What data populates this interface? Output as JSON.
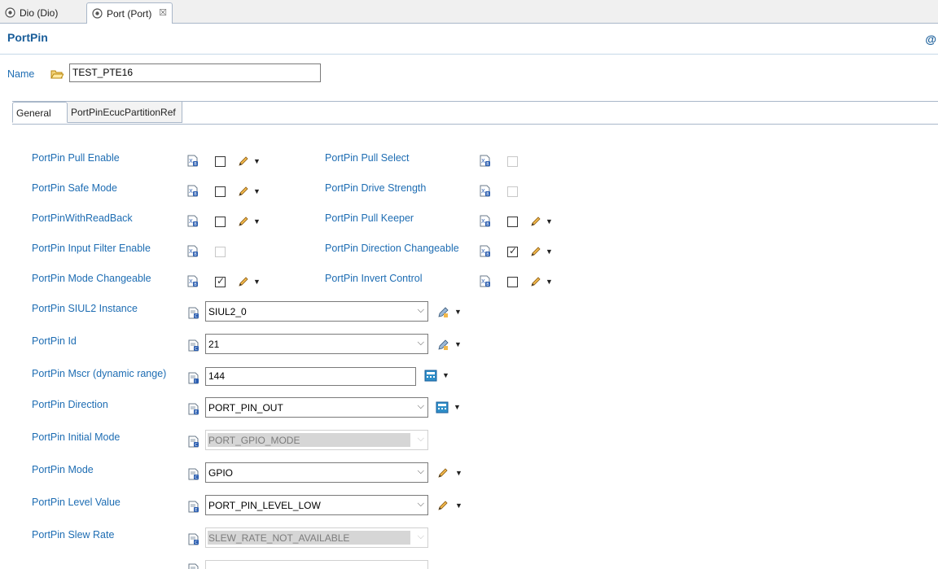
{
  "editor_tabs": [
    {
      "label": "Dio (Dio)"
    },
    {
      "label": "Port (Port)",
      "close": "☒"
    }
  ],
  "header": {
    "title": "PortPin",
    "help_symbol": "@"
  },
  "name_field": {
    "label": "Name",
    "value": "TEST_PTE16"
  },
  "inner_tabs": [
    "General",
    "PortPinEcucPartitionRef"
  ],
  "left_checkbox_rows": [
    {
      "label": "PortPin Pull Enable",
      "checked": false,
      "enabled": true
    },
    {
      "label": "PortPin Safe Mode",
      "checked": false,
      "enabled": true
    },
    {
      "label": "PortPinWithReadBack",
      "checked": false,
      "enabled": true
    },
    {
      "label": "PortPin Input Filter Enable",
      "checked": false,
      "enabled": false
    },
    {
      "label": "PortPin Mode Changeable",
      "checked": true,
      "enabled": true
    }
  ],
  "right_checkbox_rows": [
    {
      "label": "PortPin Pull Select",
      "checked": false,
      "enabled": false
    },
    {
      "label": "PortPin Drive Strength",
      "checked": false,
      "enabled": false
    },
    {
      "label": "PortPin Pull Keeper",
      "checked": false,
      "enabled": true
    },
    {
      "label": "PortPin Direction Changeable",
      "checked": true,
      "enabled": true
    },
    {
      "label": "PortPin Invert Control",
      "checked": false,
      "enabled": true
    }
  ],
  "field_rows": [
    {
      "label": "PortPin SIUL2 Instance",
      "value": "SIUL2_0",
      "kind": "combo",
      "enabled": true
    },
    {
      "label": "PortPin Id",
      "value": "21",
      "kind": "combo",
      "enabled": true
    },
    {
      "label": "PortPin Mscr (dynamic range)",
      "value": "144",
      "kind": "text",
      "enabled": true
    },
    {
      "label": "PortPin Direction",
      "value": "PORT_PIN_OUT",
      "kind": "combo",
      "enabled": true
    },
    {
      "label": "PortPin Initial Mode",
      "value": "PORT_GPIO_MODE",
      "kind": "combo",
      "enabled": false
    },
    {
      "label": "PortPin Mode",
      "value": "GPIO",
      "kind": "combo",
      "enabled": true
    },
    {
      "label": "PortPin Level Value",
      "value": "PORT_PIN_LEVEL_LOW",
      "kind": "combo",
      "enabled": true
    },
    {
      "label": "PortPin Slew Rate",
      "value": "SLEW_RATE_NOT_AVAILABLE",
      "kind": "combo",
      "enabled": false
    }
  ],
  "colors": {
    "label_blue": "#1e6db3",
    "title_blue": "#1a5e9a",
    "border": "#a9b7c9"
  }
}
